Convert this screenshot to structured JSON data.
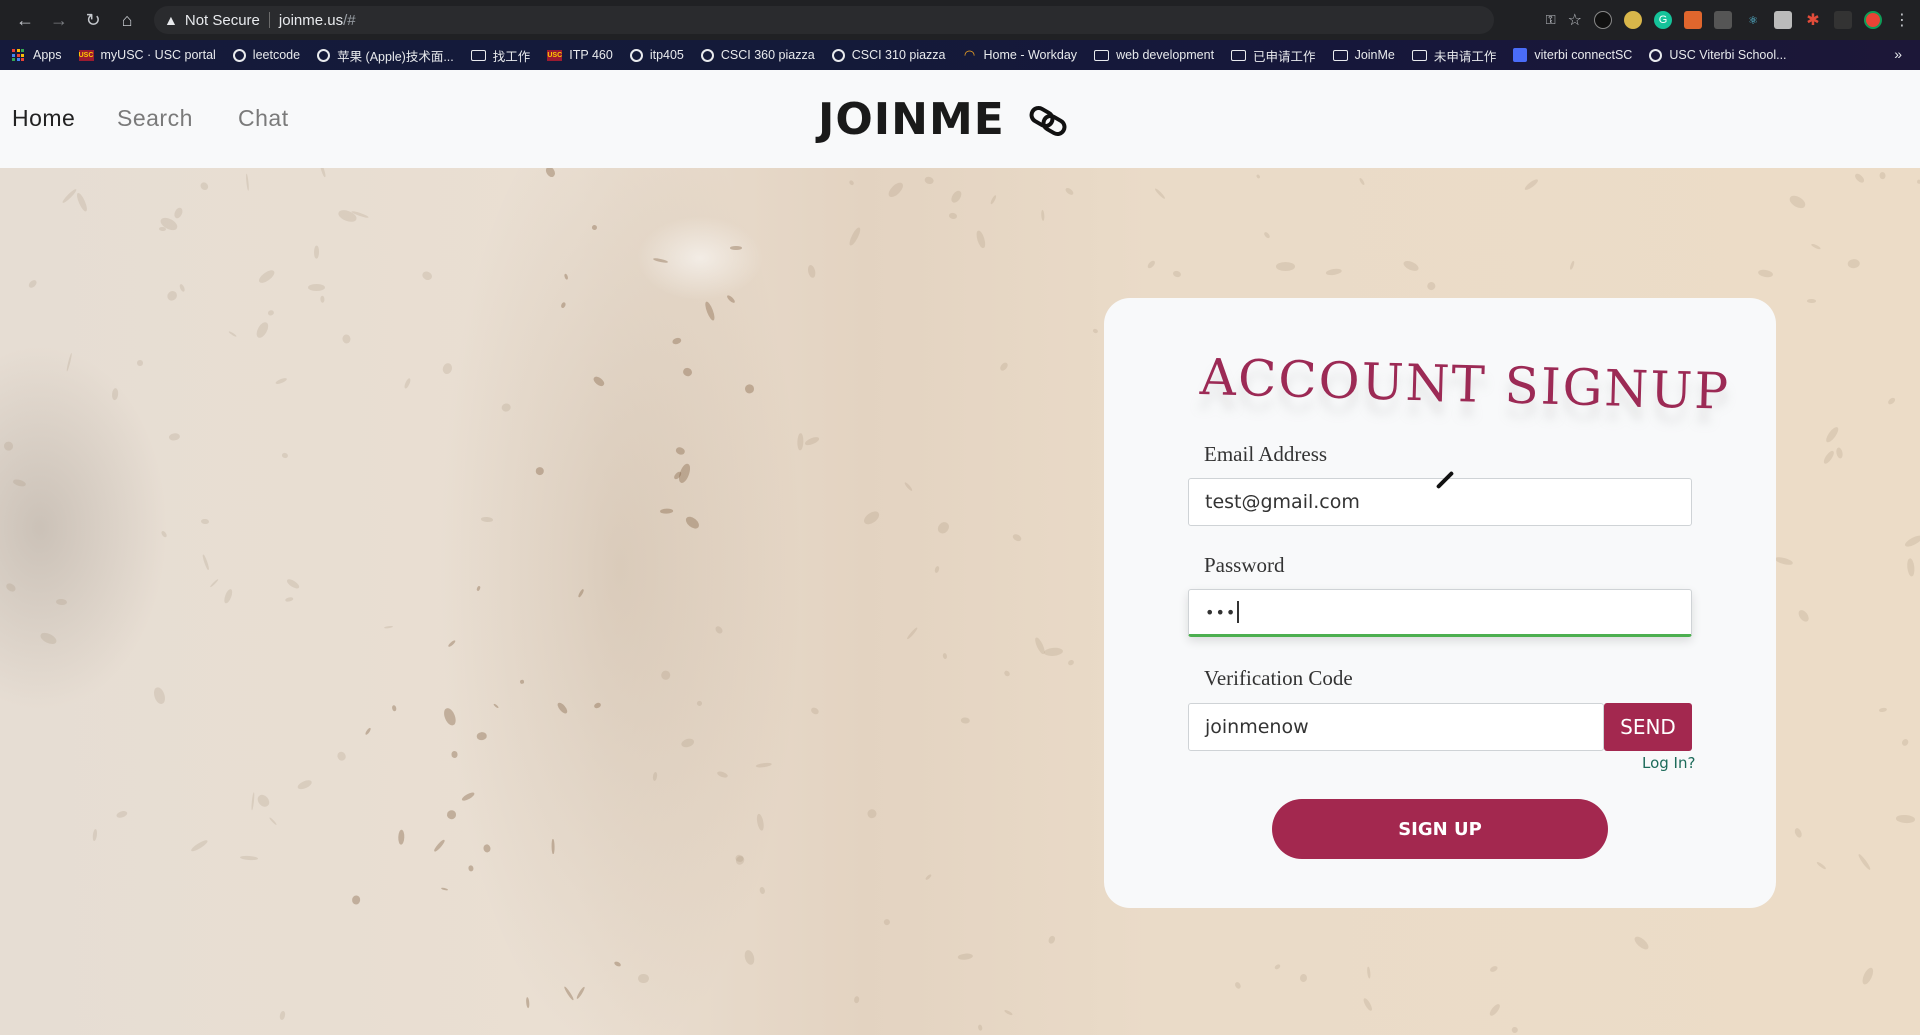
{
  "browser": {
    "security_label": "Not Secure",
    "url_host": "joinme.us",
    "url_rest": "/#",
    "bookmarks": [
      {
        "label": "Apps",
        "icon": "apps-icon"
      },
      {
        "label": "myUSC · USC portal",
        "icon": "usc-icon"
      },
      {
        "label": "leetcode",
        "icon": "globe-icon"
      },
      {
        "label": "苹果 (Apple)技术面...",
        "icon": "globe-icon"
      },
      {
        "label": "找工作",
        "icon": "folder-icon"
      },
      {
        "label": "ITP 460",
        "icon": "usc-icon"
      },
      {
        "label": "itp405",
        "icon": "globe-icon"
      },
      {
        "label": "CSCI 360 piazza",
        "icon": "globe-icon"
      },
      {
        "label": "CSCI 310 piazza",
        "icon": "globe-icon"
      },
      {
        "label": "Home - Workday",
        "icon": "workday-icon"
      },
      {
        "label": "web development",
        "icon": "folder-icon"
      },
      {
        "label": "已申请工作",
        "icon": "folder-icon"
      },
      {
        "label": "JoinMe",
        "icon": "folder-icon"
      },
      {
        "label": "未申请工作",
        "icon": "folder-icon"
      },
      {
        "label": "viterbi connectSC",
        "icon": "square-icon"
      },
      {
        "label": "USC Viterbi School...",
        "icon": "globe-icon"
      }
    ],
    "more_label": "»"
  },
  "header": {
    "nav": [
      "Home",
      "Search",
      "Chat"
    ],
    "active": "Home",
    "logo": "JOINME"
  },
  "signup": {
    "title": "ACCOUNT SIGNUP",
    "email_label": "Email Address",
    "email_value": "test@gmail.com",
    "password_label": "Password",
    "password_value": "•••",
    "code_label": "Verification Code",
    "code_value": "joinmenow",
    "send_label": "SEND",
    "login_link": "Log In?",
    "submit_label": "SIGN UP"
  },
  "colors": {
    "brand": "#a3284f",
    "focus": "#4caf50",
    "link": "#1d6b5a"
  }
}
